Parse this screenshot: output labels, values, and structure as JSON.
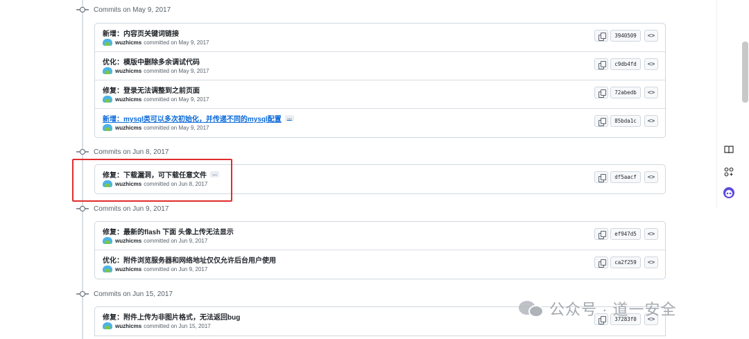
{
  "groups": [
    {
      "title": "Commits on May 9, 2017",
      "commits": [
        {
          "message": "新增：内容页关键词链接",
          "author": "wuzhicms",
          "date": "committed on May 9, 2017",
          "sha": "3940509"
        },
        {
          "message": "优化：模版中删除多余调试代码",
          "author": "wuzhicms",
          "date": "committed on May 9, 2017",
          "sha": "c9db4fd"
        },
        {
          "message": "修复：登录无法调整到之前页面",
          "author": "wuzhicms",
          "date": "committed on May 9, 2017",
          "sha": "72abedb"
        },
        {
          "message": "新增：mysql类可以多次初始化，并传递不同的mysql配置",
          "author": "wuzhicms",
          "date": "committed on May 9, 2017",
          "sha": "85bda1c",
          "ellipsis": "…"
        }
      ]
    },
    {
      "title": "Commits on Jun 8, 2017",
      "commits": [
        {
          "message": "修复：下载漏洞，可下载任意文件",
          "author": "wuzhicms",
          "date": "committed on Jun 8, 2017",
          "sha": "df5aacf",
          "ellipsis": "…"
        }
      ]
    },
    {
      "title": "Commits on Jun 9, 2017",
      "commits": [
        {
          "message": "修复：最新的flash 下面 头像上传无法显示",
          "author": "wuzhicms",
          "date": "committed on Jun 9, 2017",
          "sha": "ef947d5"
        },
        {
          "message": "优化：附件浏览服务器和网络地址仅仅允许后台用户使用",
          "author": "wuzhicms",
          "date": "committed on Jun 9, 2017",
          "sha": "ca2f259"
        }
      ]
    },
    {
      "title": "Commits on Jun 15, 2017",
      "commits": [
        {
          "message": "修复：附件上传为非图片格式，无法返回bug",
          "author": "wuzhicms",
          "date": "committed on Jun 15, 2017",
          "sha": "37283f0"
        }
      ]
    }
  ],
  "browse_label": "<>",
  "watermark": "公众号 · 道一安全",
  "sidebar": {
    "icons": [
      "book-icon",
      "apps-icon",
      "bot-icon"
    ]
  },
  "colors": {
    "highlight": "#e02c2c",
    "link": "#0969da"
  }
}
